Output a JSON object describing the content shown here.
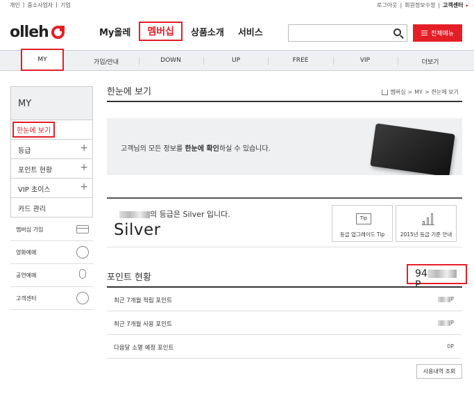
{
  "util": {
    "left": [
      "개인",
      "|",
      "중소사업자",
      "|",
      "기업"
    ],
    "logout": "로그아웃",
    "sep1": "|",
    "edit_info": "회원정보수정",
    "sep2": "|",
    "customer_center": "고객센터"
  },
  "header": {
    "logo": "olleh",
    "gnb": [
      "My올레",
      "멤버십",
      "상품소개",
      "서비스"
    ],
    "active_gnb": "멤버십",
    "search_placeholder": "",
    "all_menu": "전체메뉴"
  },
  "subnav": {
    "items": [
      "MY",
      "가입/안내",
      "DOWN",
      "UP",
      "FREE",
      "VIP",
      "더보기"
    ]
  },
  "lnb": {
    "head": "MY",
    "items": [
      {
        "label": "한눈에 보기",
        "expandable": false,
        "active": true
      },
      {
        "label": "등급",
        "expandable": true,
        "active": false
      },
      {
        "label": "포인트 현황",
        "expandable": true,
        "active": false
      },
      {
        "label": "VIP 초이스",
        "expandable": true,
        "active": false
      },
      {
        "label": "카드 관리",
        "expandable": false,
        "active": false
      }
    ],
    "util": [
      {
        "label": "멤버십 가입",
        "icon": "card-icon"
      },
      {
        "label": "영화예매",
        "icon": "film-reel-icon"
      },
      {
        "label": "공연예매",
        "icon": "microphone-icon"
      },
      {
        "label": "고객센터",
        "icon": "person-icon"
      }
    ]
  },
  "main": {
    "title": "한눈에 보기",
    "breadcrumb": [
      "멤버십",
      ">",
      "MY",
      ">",
      "한눈에 보기"
    ],
    "banner": {
      "pre": "고객님의 모든 정보를 ",
      "bold": "한눈에 확인",
      "post": "하실 수 있습니다."
    },
    "grade": {
      "suffix": "의 등급은 Silver 입니다.",
      "level": "Silver",
      "btn_tip_icon": "Tip",
      "btn_tip": "등급 업그레이드 Tip",
      "btn_criteria": "2015년 등급 기준 안내"
    },
    "points": {
      "title": "포인트 현황",
      "total_prefix": "94",
      "total_suffix": "P",
      "rows": [
        {
          "label": "최근 7개월 적립 포인트",
          "value": "P"
        },
        {
          "label": "최근 7개월 사용 포인트",
          "value": "P"
        },
        {
          "label": "다음달 소멸 예정 포인트",
          "value": "0P"
        }
      ],
      "history_btn": "사용내역 조회"
    }
  },
  "colors": {
    "accent": "#e41e26",
    "panel": "#eef0f2"
  }
}
